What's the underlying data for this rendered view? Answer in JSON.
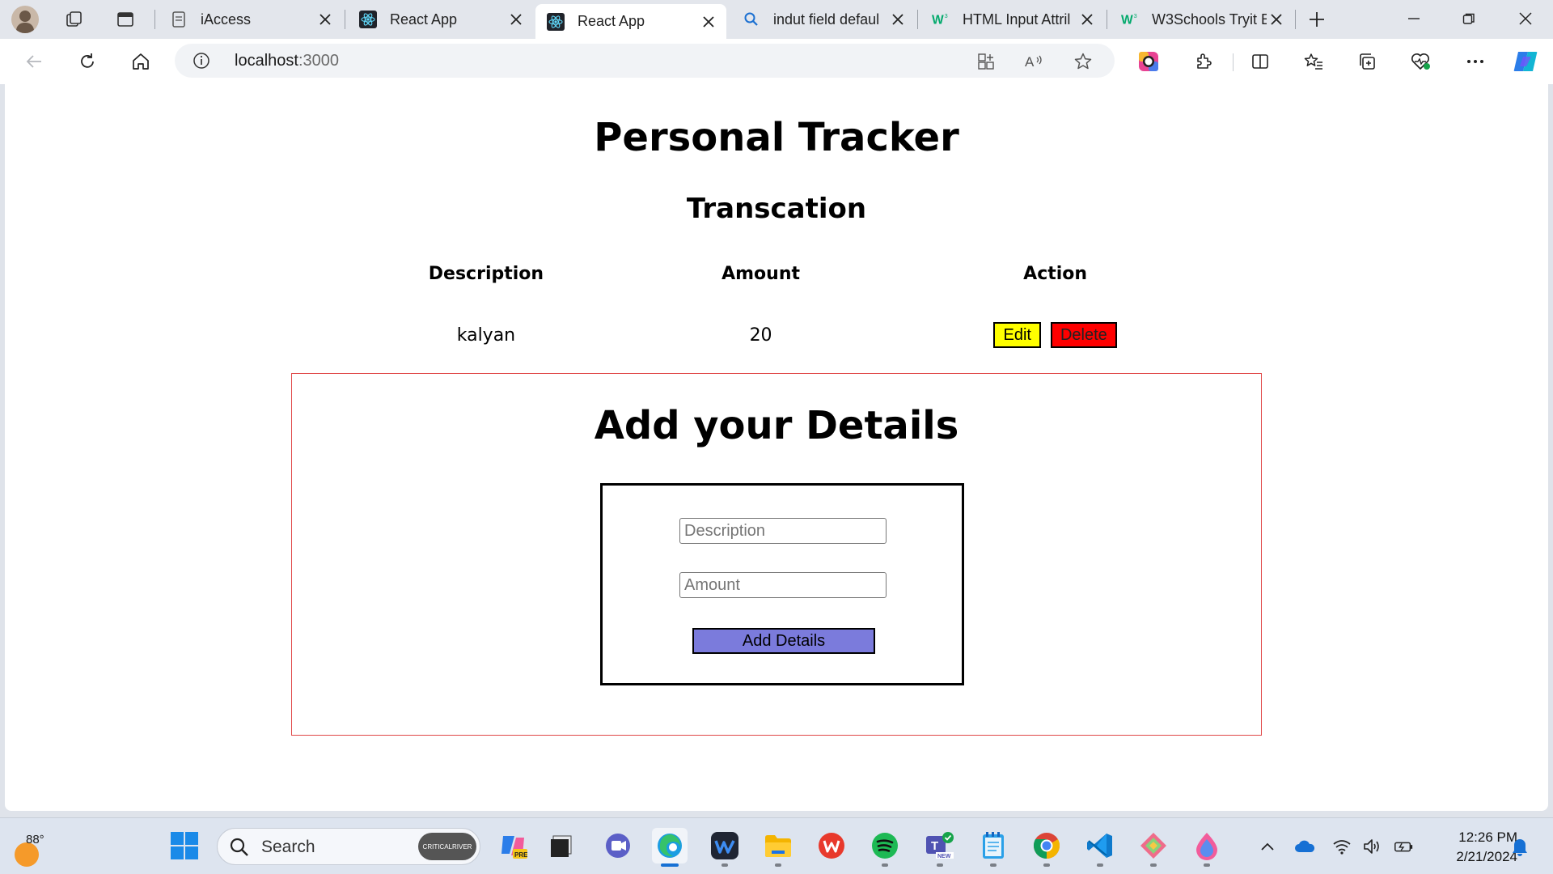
{
  "browser": {
    "tabs": [
      {
        "label": "iAccess",
        "favicon": "page-icon",
        "active": false
      },
      {
        "label": "React App",
        "favicon": "react-icon",
        "active": false
      },
      {
        "label": "React App",
        "favicon": "react-icon",
        "active": true
      },
      {
        "label": "indut field defaul",
        "favicon": "search-icon",
        "active": false
      },
      {
        "label": "HTML Input Attril",
        "favicon": "w3schools-icon",
        "active": false
      },
      {
        "label": "W3Schools Tryit E",
        "favicon": "w3schools-icon",
        "active": false
      }
    ],
    "address": {
      "host": "localhost",
      "port": ":3000"
    }
  },
  "page": {
    "title": "Personal Tracker",
    "transactions_heading": "Transcation",
    "table": {
      "headers": [
        "Description",
        "Amount",
        "Action"
      ],
      "rows": [
        {
          "description": "kalyan",
          "amount": "20",
          "edit_label": "Edit",
          "delete_label": "Delete"
        }
      ]
    },
    "form": {
      "heading": "Add your Details",
      "description_placeholder": "Description",
      "description_value": "",
      "amount_placeholder": "Amount",
      "amount_value": "",
      "submit_label": "Add Details"
    }
  },
  "taskbar": {
    "weather_temp": "88°",
    "search_label": "Search",
    "search_promo": "CRITICALRIVER",
    "clock_time": "12:26 PM",
    "clock_date": "2/21/2024",
    "apps": [
      "copilot-pre",
      "task-view",
      "teams-chat",
      "edge",
      "webex",
      "file-explorer",
      "wps-office",
      "spotify",
      "teams-new",
      "notepad",
      "chrome",
      "vscode",
      "git-tool",
      "paint"
    ]
  },
  "colors": {
    "edit_button": "#ffff00",
    "delete_button": "#ff0000",
    "add_button": "#7b7bdc",
    "details_border": "#e04848",
    "taskbar_bg": "#dde4ef"
  }
}
